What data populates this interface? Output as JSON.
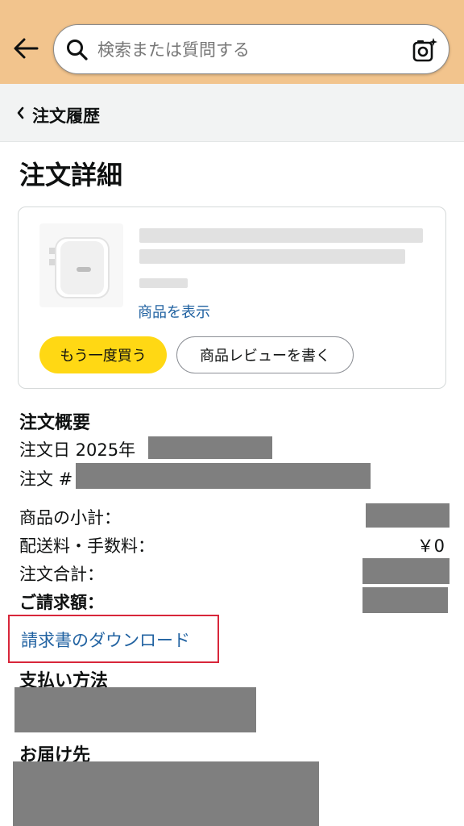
{
  "header": {
    "search_placeholder": "検索または質問する"
  },
  "breadcrumb": {
    "label": "注文履歴"
  },
  "page": {
    "title": "注文詳細"
  },
  "product": {
    "view_link": "商品を表示",
    "buy_again": "もう一度買う",
    "write_review": "商品レビューを書く"
  },
  "summary": {
    "title": "注文概要",
    "order_date_label": "注文日 2025年",
    "order_number_label": "注文 #",
    "subtotal_label": "商品の小計：",
    "shipping_label": "配送料・手数料：",
    "shipping_value": "￥0",
    "total_label": "注文合計：",
    "billed_label": "ご請求額："
  },
  "invoice": {
    "download_label": "請求書のダウンロード"
  },
  "payment": {
    "title": "支払い方法"
  },
  "shipping_address": {
    "title": "お届け先"
  }
}
